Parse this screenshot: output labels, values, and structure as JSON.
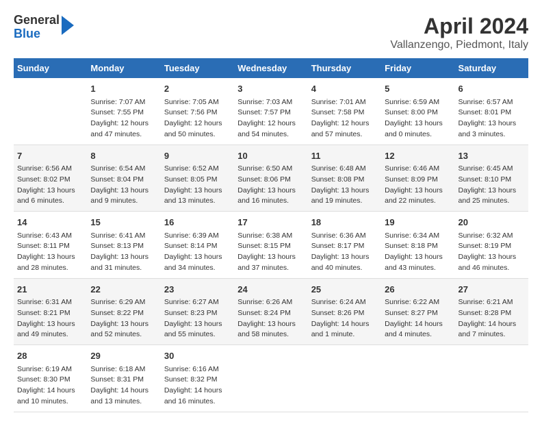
{
  "header": {
    "logo_general": "General",
    "logo_blue": "Blue",
    "title": "April 2024",
    "subtitle": "Vallanzengo, Piedmont, Italy"
  },
  "columns": [
    "Sunday",
    "Monday",
    "Tuesday",
    "Wednesday",
    "Thursday",
    "Friday",
    "Saturday"
  ],
  "rows": [
    [
      {
        "day": "",
        "sunrise": "",
        "sunset": "",
        "daylight": ""
      },
      {
        "day": "1",
        "sunrise": "Sunrise: 7:07 AM",
        "sunset": "Sunset: 7:55 PM",
        "daylight": "Daylight: 12 hours and 47 minutes."
      },
      {
        "day": "2",
        "sunrise": "Sunrise: 7:05 AM",
        "sunset": "Sunset: 7:56 PM",
        "daylight": "Daylight: 12 hours and 50 minutes."
      },
      {
        "day": "3",
        "sunrise": "Sunrise: 7:03 AM",
        "sunset": "Sunset: 7:57 PM",
        "daylight": "Daylight: 12 hours and 54 minutes."
      },
      {
        "day": "4",
        "sunrise": "Sunrise: 7:01 AM",
        "sunset": "Sunset: 7:58 PM",
        "daylight": "Daylight: 12 hours and 57 minutes."
      },
      {
        "day": "5",
        "sunrise": "Sunrise: 6:59 AM",
        "sunset": "Sunset: 8:00 PM",
        "daylight": "Daylight: 13 hours and 0 minutes."
      },
      {
        "day": "6",
        "sunrise": "Sunrise: 6:57 AM",
        "sunset": "Sunset: 8:01 PM",
        "daylight": "Daylight: 13 hours and 3 minutes."
      }
    ],
    [
      {
        "day": "7",
        "sunrise": "Sunrise: 6:56 AM",
        "sunset": "Sunset: 8:02 PM",
        "daylight": "Daylight: 13 hours and 6 minutes."
      },
      {
        "day": "8",
        "sunrise": "Sunrise: 6:54 AM",
        "sunset": "Sunset: 8:04 PM",
        "daylight": "Daylight: 13 hours and 9 minutes."
      },
      {
        "day": "9",
        "sunrise": "Sunrise: 6:52 AM",
        "sunset": "Sunset: 8:05 PM",
        "daylight": "Daylight: 13 hours and 13 minutes."
      },
      {
        "day": "10",
        "sunrise": "Sunrise: 6:50 AM",
        "sunset": "Sunset: 8:06 PM",
        "daylight": "Daylight: 13 hours and 16 minutes."
      },
      {
        "day": "11",
        "sunrise": "Sunrise: 6:48 AM",
        "sunset": "Sunset: 8:08 PM",
        "daylight": "Daylight: 13 hours and 19 minutes."
      },
      {
        "day": "12",
        "sunrise": "Sunrise: 6:46 AM",
        "sunset": "Sunset: 8:09 PM",
        "daylight": "Daylight: 13 hours and 22 minutes."
      },
      {
        "day": "13",
        "sunrise": "Sunrise: 6:45 AM",
        "sunset": "Sunset: 8:10 PM",
        "daylight": "Daylight: 13 hours and 25 minutes."
      }
    ],
    [
      {
        "day": "14",
        "sunrise": "Sunrise: 6:43 AM",
        "sunset": "Sunset: 8:11 PM",
        "daylight": "Daylight: 13 hours and 28 minutes."
      },
      {
        "day": "15",
        "sunrise": "Sunrise: 6:41 AM",
        "sunset": "Sunset: 8:13 PM",
        "daylight": "Daylight: 13 hours and 31 minutes."
      },
      {
        "day": "16",
        "sunrise": "Sunrise: 6:39 AM",
        "sunset": "Sunset: 8:14 PM",
        "daylight": "Daylight: 13 hours and 34 minutes."
      },
      {
        "day": "17",
        "sunrise": "Sunrise: 6:38 AM",
        "sunset": "Sunset: 8:15 PM",
        "daylight": "Daylight: 13 hours and 37 minutes."
      },
      {
        "day": "18",
        "sunrise": "Sunrise: 6:36 AM",
        "sunset": "Sunset: 8:17 PM",
        "daylight": "Daylight: 13 hours and 40 minutes."
      },
      {
        "day": "19",
        "sunrise": "Sunrise: 6:34 AM",
        "sunset": "Sunset: 8:18 PM",
        "daylight": "Daylight: 13 hours and 43 minutes."
      },
      {
        "day": "20",
        "sunrise": "Sunrise: 6:32 AM",
        "sunset": "Sunset: 8:19 PM",
        "daylight": "Daylight: 13 hours and 46 minutes."
      }
    ],
    [
      {
        "day": "21",
        "sunrise": "Sunrise: 6:31 AM",
        "sunset": "Sunset: 8:21 PM",
        "daylight": "Daylight: 13 hours and 49 minutes."
      },
      {
        "day": "22",
        "sunrise": "Sunrise: 6:29 AM",
        "sunset": "Sunset: 8:22 PM",
        "daylight": "Daylight: 13 hours and 52 minutes."
      },
      {
        "day": "23",
        "sunrise": "Sunrise: 6:27 AM",
        "sunset": "Sunset: 8:23 PM",
        "daylight": "Daylight: 13 hours and 55 minutes."
      },
      {
        "day": "24",
        "sunrise": "Sunrise: 6:26 AM",
        "sunset": "Sunset: 8:24 PM",
        "daylight": "Daylight: 13 hours and 58 minutes."
      },
      {
        "day": "25",
        "sunrise": "Sunrise: 6:24 AM",
        "sunset": "Sunset: 8:26 PM",
        "daylight": "Daylight: 14 hours and 1 minute."
      },
      {
        "day": "26",
        "sunrise": "Sunrise: 6:22 AM",
        "sunset": "Sunset: 8:27 PM",
        "daylight": "Daylight: 14 hours and 4 minutes."
      },
      {
        "day": "27",
        "sunrise": "Sunrise: 6:21 AM",
        "sunset": "Sunset: 8:28 PM",
        "daylight": "Daylight: 14 hours and 7 minutes."
      }
    ],
    [
      {
        "day": "28",
        "sunrise": "Sunrise: 6:19 AM",
        "sunset": "Sunset: 8:30 PM",
        "daylight": "Daylight: 14 hours and 10 minutes."
      },
      {
        "day": "29",
        "sunrise": "Sunrise: 6:18 AM",
        "sunset": "Sunset: 8:31 PM",
        "daylight": "Daylight: 14 hours and 13 minutes."
      },
      {
        "day": "30",
        "sunrise": "Sunrise: 6:16 AM",
        "sunset": "Sunset: 8:32 PM",
        "daylight": "Daylight: 14 hours and 16 minutes."
      },
      {
        "day": "",
        "sunrise": "",
        "sunset": "",
        "daylight": ""
      },
      {
        "day": "",
        "sunrise": "",
        "sunset": "",
        "daylight": ""
      },
      {
        "day": "",
        "sunrise": "",
        "sunset": "",
        "daylight": ""
      },
      {
        "day": "",
        "sunrise": "",
        "sunset": "",
        "daylight": ""
      }
    ]
  ]
}
